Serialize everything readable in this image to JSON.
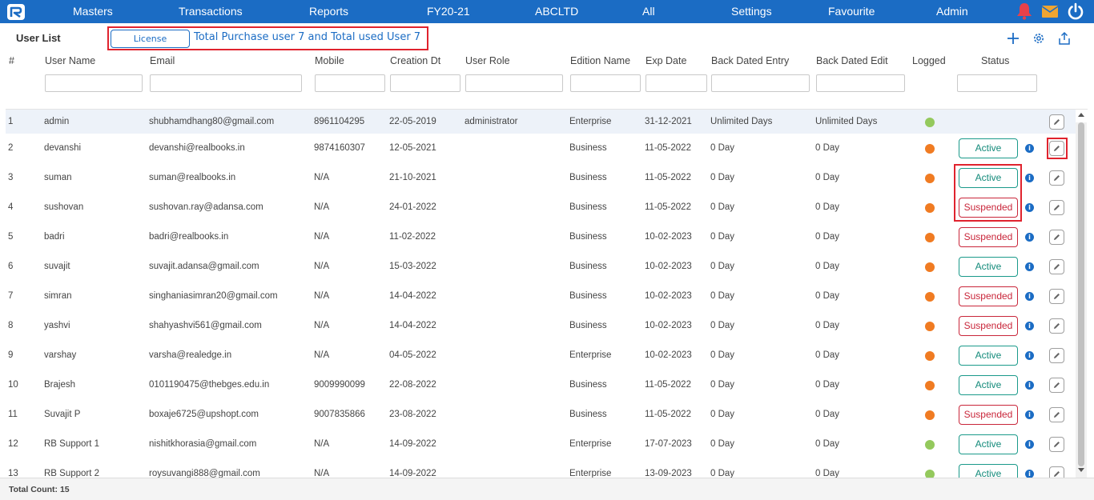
{
  "nav": {
    "items": [
      "Masters",
      "Transactions",
      "Reports",
      "FY20-21",
      "ABCLTD",
      "All",
      "Settings",
      "Favourite",
      "Admin"
    ],
    "colors": {
      "bar": "#1b6cc4",
      "bell": "#e8414a",
      "mail": "#f0a531"
    }
  },
  "page": {
    "title": "User List",
    "license_button": "License",
    "license_text": "Total Purchase user 7 and Total used User 7"
  },
  "table": {
    "headers": [
      "#",
      "User Name",
      "Email",
      "Mobile",
      "Creation Dt",
      "User Role",
      "Edition Name",
      "Exp Date",
      "Back Dated Entry",
      "Back Dated Edit",
      "Logged",
      "Status"
    ],
    "rows": [
      {
        "num": "1",
        "name": "admin",
        "email": "shubhamdhang80@gmail.com",
        "mobile": "8961104295",
        "created": "22-05-2019",
        "role": "administrator",
        "edition": "Enterprise",
        "exp": "31-12-2021",
        "bde": "Unlimited Days",
        "bdedit": "Unlimited Days",
        "logged": "green",
        "status": ""
      },
      {
        "num": "2",
        "name": "devanshi",
        "email": "devanshi@realbooks.in",
        "mobile": "9874160307",
        "created": "12-05-2021",
        "role": "",
        "edition": "Business",
        "exp": "11-05-2022",
        "bde": "0 Day",
        "bdedit": "0 Day",
        "logged": "orange",
        "status": "Active"
      },
      {
        "num": "3",
        "name": "suman",
        "email": "suman@realbooks.in",
        "mobile": "N/A",
        "created": "21-10-2021",
        "role": "",
        "edition": "Business",
        "exp": "11-05-2022",
        "bde": "0 Day",
        "bdedit": "0 Day",
        "logged": "orange",
        "status": "Active"
      },
      {
        "num": "4",
        "name": "sushovan",
        "email": "sushovan.ray@adansa.com",
        "mobile": "N/A",
        "created": "24-01-2022",
        "role": "",
        "edition": "Business",
        "exp": "11-05-2022",
        "bde": "0 Day",
        "bdedit": "0 Day",
        "logged": "orange",
        "status": "Suspended"
      },
      {
        "num": "5",
        "name": "badri",
        "email": "badri@realbooks.in",
        "mobile": "N/A",
        "created": "11-02-2022",
        "role": "",
        "edition": "Business",
        "exp": "10-02-2023",
        "bde": "0 Day",
        "bdedit": "0 Day",
        "logged": "orange",
        "status": "Suspended"
      },
      {
        "num": "6",
        "name": "suvajit",
        "email": "suvajit.adansa@gmail.com",
        "mobile": "N/A",
        "created": "15-03-2022",
        "role": "",
        "edition": "Business",
        "exp": "10-02-2023",
        "bde": "0 Day",
        "bdedit": "0 Day",
        "logged": "orange",
        "status": "Active"
      },
      {
        "num": "7",
        "name": "simran",
        "email": "singhaniasimran20@gmail.com",
        "mobile": "N/A",
        "created": "14-04-2022",
        "role": "",
        "edition": "Business",
        "exp": "10-02-2023",
        "bde": "0 Day",
        "bdedit": "0 Day",
        "logged": "orange",
        "status": "Suspended"
      },
      {
        "num": "8",
        "name": "yashvi",
        "email": "shahyashvi561@gmail.com",
        "mobile": "N/A",
        "created": "14-04-2022",
        "role": "",
        "edition": "Business",
        "exp": "10-02-2023",
        "bde": "0 Day",
        "bdedit": "0 Day",
        "logged": "orange",
        "status": "Suspended"
      },
      {
        "num": "9",
        "name": "varshay",
        "email": "varsha@realedge.in",
        "mobile": "N/A",
        "created": "04-05-2022",
        "role": "",
        "edition": "Enterprise",
        "exp": "10-02-2023",
        "bde": "0 Day",
        "bdedit": "0 Day",
        "logged": "orange",
        "status": "Active"
      },
      {
        "num": "10",
        "name": "Brajesh",
        "email": "0101190475@thebges.edu.in",
        "mobile": "9009990099",
        "created": "22-08-2022",
        "role": "",
        "edition": "Business",
        "exp": "11-05-2022",
        "bde": "0 Day",
        "bdedit": "0 Day",
        "logged": "orange",
        "status": "Active"
      },
      {
        "num": "11",
        "name": "Suvajit P",
        "email": "boxaje6725@upshopt.com",
        "mobile": "9007835866",
        "created": "23-08-2022",
        "role": "",
        "edition": "Business",
        "exp": "11-05-2022",
        "bde": "0 Day",
        "bdedit": "0 Day",
        "logged": "orange",
        "status": "Suspended"
      },
      {
        "num": "12",
        "name": "RB Support 1",
        "email": "nishitkhorasia@gmail.com",
        "mobile": "N/A",
        "created": "14-09-2022",
        "role": "",
        "edition": "Enterprise",
        "exp": "17-07-2023",
        "bde": "0 Day",
        "bdedit": "0 Day",
        "logged": "green",
        "status": "Active"
      },
      {
        "num": "13",
        "name": "RB Support 2",
        "email": "roysuvangi888@gmail.com",
        "mobile": "N/A",
        "created": "14-09-2022",
        "role": "",
        "edition": "Enterprise",
        "exp": "13-09-2023",
        "bde": "0 Day",
        "bdedit": "0 Day",
        "logged": "green",
        "status": "Active"
      }
    ],
    "logged_colors": {
      "green": "#94c95d",
      "orange": "#f07b22"
    }
  },
  "footer": {
    "total_label": "Total Count: 15"
  }
}
